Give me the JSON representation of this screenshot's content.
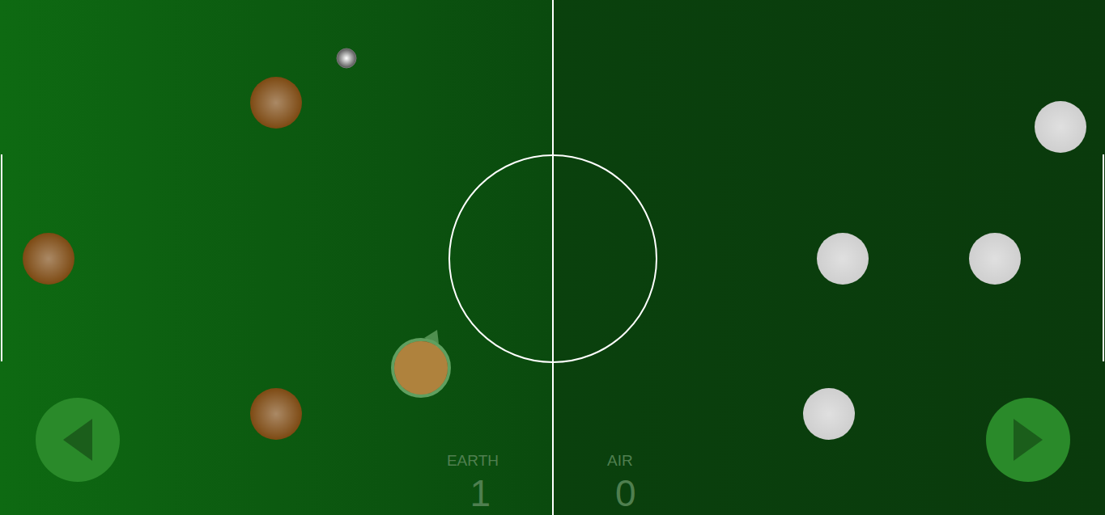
{
  "teams": [
    {
      "name": "EARTH",
      "score": "1",
      "color": "#7d4a13",
      "players": [
        {
          "selected": false
        },
        {
          "selected": false
        },
        {
          "selected": false
        },
        {
          "selected": true
        }
      ]
    },
    {
      "name": "AIR",
      "score": "0",
      "color": "#cfcfcf",
      "players": [
        {
          "selected": false
        },
        {
          "selected": false
        },
        {
          "selected": false
        },
        {
          "selected": false
        }
      ]
    }
  ],
  "controls": [
    {
      "kind": "left"
    },
    {
      "kind": "right"
    }
  ]
}
